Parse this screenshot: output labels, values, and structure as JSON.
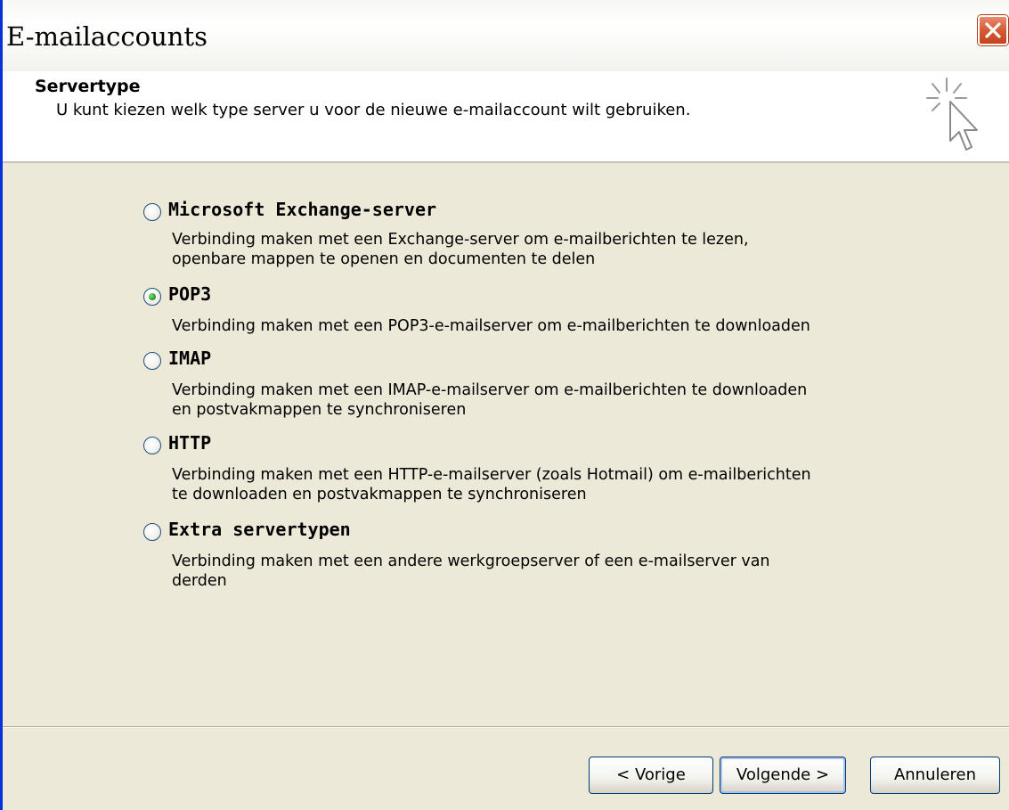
{
  "window": {
    "title": "E-mailaccounts"
  },
  "header": {
    "title": "Servertype",
    "subtitle": "U kunt kiezen welk type server u voor de nieuwe e-mailaccount wilt gebruiken."
  },
  "options": [
    {
      "label": "Microsoft Exchange-server",
      "desc": [
        "Verbinding maken met een Exchange-server om e-mailberichten te lezen,",
        "openbare mappen te openen en documenten te delen"
      ],
      "checked": false
    },
    {
      "label": "POP3",
      "desc": [
        "Verbinding maken met een POP3-e-mailserver om e-mailberichten te downloaden"
      ],
      "checked": true
    },
    {
      "label": "IMAP",
      "desc": [
        "Verbinding maken met een IMAP-e-mailserver om e-mailberichten te downloaden",
        "en postvakmappen te synchroniseren"
      ],
      "checked": false
    },
    {
      "label": "HTTP",
      "desc": [
        "Verbinding maken met een HTTP-e-mailserver (zoals Hotmail) om e-mailberichten",
        "te downloaden en postvakmappen te synchroniseren"
      ],
      "checked": false
    },
    {
      "label": "Extra servertypen",
      "desc": [
        "Verbinding maken met een andere werkgroepserver of een e-mailserver van",
        "derden"
      ],
      "checked": false
    }
  ],
  "buttons": {
    "back": "< Vorige",
    "next": "Volgende >",
    "cancel": "Annuleren"
  },
  "icons": {
    "close": "close-icon",
    "wizard": "cursor-sparkle-icon"
  },
  "colors": {
    "accent": "#0831d9",
    "close": "#d65a36",
    "selected_radio": "#2f9e2f"
  }
}
